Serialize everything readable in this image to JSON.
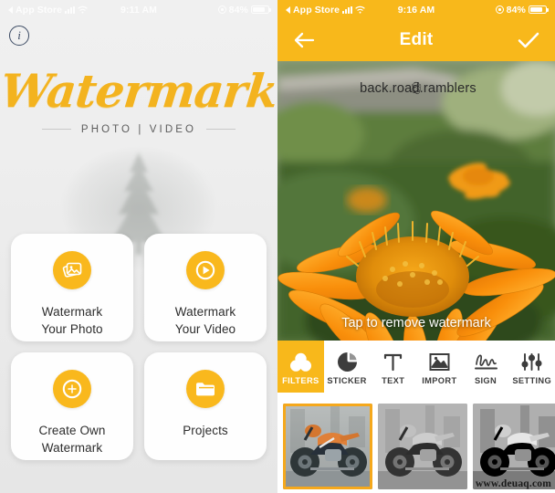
{
  "accent_color": "#f8b81b",
  "left_screen": {
    "status_bar": {
      "carrier": "App Store",
      "time": "9:11 AM",
      "battery": "84%"
    },
    "info_icon": "i",
    "brand": {
      "title": "Watermark",
      "subtitle": "PHOTO | VIDEO"
    },
    "cards": [
      {
        "icon": "photos-icon",
        "label": "Watermark\nYour Photo"
      },
      {
        "icon": "play-video-icon",
        "label": "Watermark\nYour Video"
      },
      {
        "icon": "plus-circle-icon",
        "label": "Create Own\nWatermark"
      },
      {
        "icon": "folder-icon",
        "label": "Projects"
      }
    ]
  },
  "right_screen": {
    "status_bar": {
      "carrier": "App Store",
      "time": "9:16 AM",
      "battery": "84%"
    },
    "navbar": {
      "title": "Edit",
      "back_icon": "arrow-left-icon",
      "confirm_icon": "check-icon"
    },
    "photo": {
      "watermark_text": "back.road.ramblers",
      "hint": "Tap to remove watermark"
    },
    "toolbar": [
      {
        "label": "FILTERS",
        "icon": "filters-icon",
        "active": true
      },
      {
        "label": "STICKER",
        "icon": "sticker-icon",
        "active": false
      },
      {
        "label": "TEXT",
        "icon": "text-icon",
        "active": false
      },
      {
        "label": "IMPORT",
        "icon": "import-image-icon",
        "active": false
      },
      {
        "label": "SIGN",
        "icon": "signature-icon",
        "active": false
      },
      {
        "label": "SETTING",
        "icon": "sliders-icon",
        "active": false
      }
    ],
    "filter_thumbnails": [
      {
        "name": "original",
        "selected": true
      },
      {
        "name": "grayscale",
        "selected": false
      },
      {
        "name": "high-contrast-mono",
        "selected": false
      }
    ]
  },
  "site_watermark": "www.deuaq.com"
}
